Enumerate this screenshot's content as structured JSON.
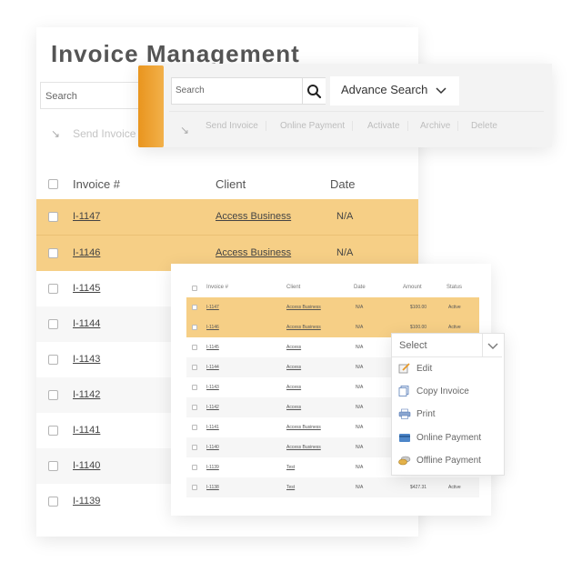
{
  "page": {
    "title": "Invoice Management",
    "search_placeholder": "Search",
    "send_invoice_label": "Send Invoice"
  },
  "table": {
    "columns": [
      "Invoice #",
      "Client",
      "Date"
    ],
    "rows": [
      {
        "invoice": "I-1147",
        "client": "Access Business",
        "date": "N/A",
        "highlight": true
      },
      {
        "invoice": "I-1146",
        "client": "Access Business",
        "date": "N/A",
        "highlight": true
      },
      {
        "invoice": "I-1145"
      },
      {
        "invoice": "I-1144"
      },
      {
        "invoice": "I-1143"
      },
      {
        "invoice": "I-1142"
      },
      {
        "invoice": "I-1141"
      },
      {
        "invoice": "I-1140"
      },
      {
        "invoice": "I-1139"
      }
    ]
  },
  "toolbar": {
    "search_placeholder": "Search",
    "advance_search_label": "Advance Search",
    "actions": [
      "Send Invoice",
      "Online Payment",
      "Activate",
      "Archive",
      "Delete"
    ]
  },
  "detail_table": {
    "columns": [
      "Invoice #",
      "Client",
      "Date",
      "Amount",
      "Status"
    ],
    "rows": [
      {
        "invoice": "I-1147",
        "client": "Access Business",
        "date": "N/A",
        "amount": "$100.00",
        "status": "Active",
        "highlight": true
      },
      {
        "invoice": "I-1146",
        "client": "Access Business",
        "date": "N/A",
        "amount": "$100.00",
        "status": "Active",
        "highlight": true
      },
      {
        "invoice": "I-1145",
        "client": "Access",
        "date": "N/A",
        "amount": "",
        "status": ""
      },
      {
        "invoice": "I-1144",
        "client": "Access",
        "date": "N/A",
        "amount": "",
        "status": ""
      },
      {
        "invoice": "I-1143",
        "client": "Access",
        "date": "N/A",
        "amount": "",
        "status": ""
      },
      {
        "invoice": "I-1142",
        "client": "Access",
        "date": "N/A",
        "amount": "",
        "status": ""
      },
      {
        "invoice": "I-1141",
        "client": "Access Business",
        "date": "N/A",
        "amount": "",
        "status": ""
      },
      {
        "invoice": "I-1140",
        "client": "Access Business",
        "date": "N/A",
        "amount": "",
        "status": ""
      },
      {
        "invoice": "I-1139",
        "client": "Test",
        "date": "N/A",
        "amount": "",
        "status": ""
      },
      {
        "invoice": "I-1138",
        "client": "Test",
        "date": "N/A",
        "amount": "$427.31",
        "status": "Active"
      }
    ]
  },
  "dropdown": {
    "selected": "Select",
    "items": [
      {
        "label": "Edit",
        "icon": "edit-icon"
      },
      {
        "label": "Copy Invoice",
        "icon": "copy-icon"
      },
      {
        "label": "Print",
        "icon": "print-icon"
      },
      {
        "label": "Online Payment",
        "icon": "card-icon"
      },
      {
        "label": "Offline Payment",
        "icon": "cash-icon"
      }
    ]
  },
  "colors": {
    "accent_orange": "#ee9f2e",
    "row_highlight": "#f6cf86",
    "panel_bg": "#f3f3f3"
  }
}
